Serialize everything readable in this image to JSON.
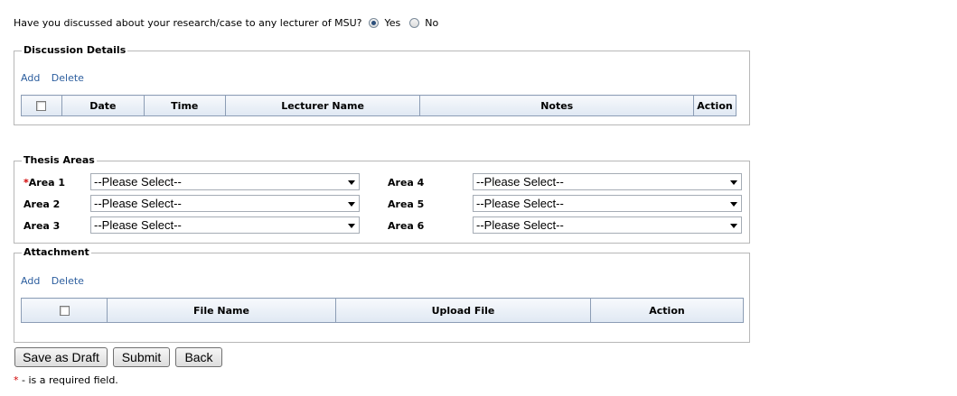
{
  "question": {
    "text": "Have you discussed about your research/case to any lecturer of MSU?",
    "yes_label": "Yes",
    "no_label": "No",
    "selected": "Yes"
  },
  "discussion": {
    "legend": "Discussion Details",
    "add_label": "Add",
    "delete_label": "Delete",
    "columns": [
      "Date",
      "Time",
      "Lecturer Name",
      "Notes",
      "Action"
    ]
  },
  "thesis": {
    "legend": "Thesis Areas",
    "required_mark": "*",
    "areas": [
      {
        "label": "Area 1",
        "value": "--Please Select--"
      },
      {
        "label": "Area 2",
        "value": "--Please Select--"
      },
      {
        "label": "Area 3",
        "value": "--Please Select--"
      },
      {
        "label": "Area 4",
        "value": "--Please Select--"
      },
      {
        "label": "Area 5",
        "value": "--Please Select--"
      },
      {
        "label": "Area 6",
        "value": "--Please Select--"
      }
    ]
  },
  "attachment": {
    "legend": "Attachment",
    "add_label": "Add",
    "delete_label": "Delete",
    "columns": [
      "File Name",
      "Upload File",
      "Action"
    ]
  },
  "buttons": {
    "save_draft": "Save as Draft",
    "submit": "Submit",
    "back": "Back"
  },
  "footnote": {
    "mark": "*",
    "text": " - is a required field."
  },
  "colors": {
    "link": "#2c5e9e",
    "required": "#d00000",
    "header_bg": "#dfe8f3"
  }
}
